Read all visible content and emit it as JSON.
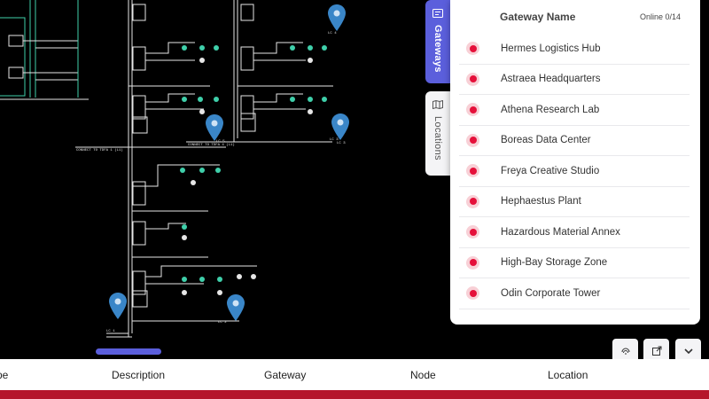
{
  "gateways_tab": {
    "label": "Gateways",
    "icon": "gateway-icon"
  },
  "locations_tab": {
    "label": "Locations",
    "icon": "map-icon"
  },
  "gateway_panel": {
    "header_name": "Gateway Name",
    "online_status": "Online 0/14",
    "items": [
      {
        "name": "Hermes Logistics Hub",
        "status": "offline"
      },
      {
        "name": "Astraea Headquarters",
        "status": "offline"
      },
      {
        "name": "Athena Research Lab",
        "status": "offline"
      },
      {
        "name": "Boreas Data Center",
        "status": "offline"
      },
      {
        "name": "Freya Creative Studio",
        "status": "offline"
      },
      {
        "name": "Hephaestus Plant",
        "status": "offline"
      },
      {
        "name": "Hazardous Material Annex",
        "status": "offline"
      },
      {
        "name": "High-Bay Storage Zone",
        "status": "offline"
      },
      {
        "name": "Odin Corporate Tower",
        "status": "offline"
      }
    ]
  },
  "controls": {
    "fingerprint_icon": "fingerprint-icon",
    "open_icon": "external-link-icon",
    "collapse_icon": "chevron-down-icon"
  },
  "table_header": {
    "type": "pe",
    "description": "Description",
    "gateway": "Gateway",
    "node": "Node",
    "location": "Location"
  },
  "schematic": {
    "labels": {
      "connect_1": "CONNECT TO TDFA 1 (L1)",
      "connect_2": "CONNECT TO TDFA 4 (L1)",
      "lc_a": "LC 4",
      "lc_b": "LC 5",
      "lc_c": "LC 3",
      "lc_d": "LC 2",
      "lc_e": "LC 1",
      "lc_f": "LC 3"
    },
    "pin_icon": "map-pin-icon"
  },
  "colors": {
    "accent": "#5b5fdc",
    "offline": "#e5103a",
    "brand_strip": "#b5152b",
    "pin": "#3a86c8",
    "wire": "#e6e6e6",
    "device": "#3fcfaa"
  }
}
